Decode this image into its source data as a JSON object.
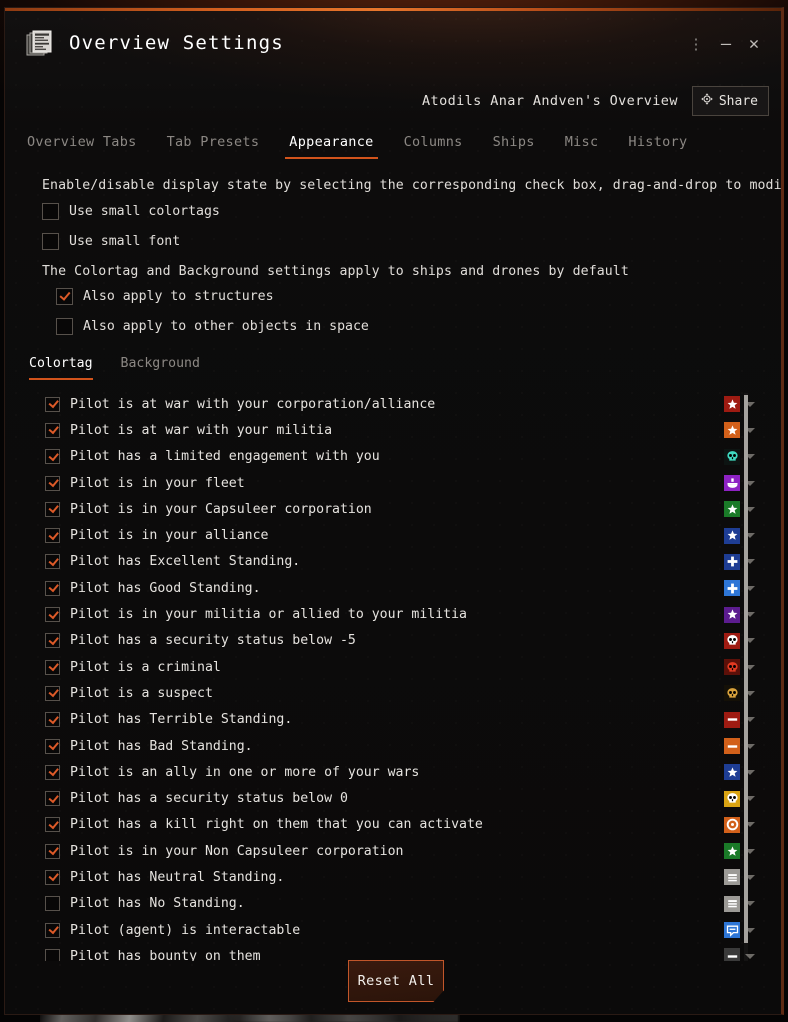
{
  "window": {
    "title": "Overview Settings",
    "icon": "overview-stack-icon",
    "more_label": "⋮",
    "minimize_label": "—",
    "close_label": "✕"
  },
  "header": {
    "overview_name": "Atodils Anar Andven's Overview",
    "share_label": "Share",
    "share_icon": "share-node-icon"
  },
  "tabs": [
    {
      "label": "Overview Tabs",
      "active": false
    },
    {
      "label": "Tab Presets",
      "active": false
    },
    {
      "label": "Appearance",
      "active": true
    },
    {
      "label": "Columns",
      "active": false
    },
    {
      "label": "Ships",
      "active": false
    },
    {
      "label": "Misc",
      "active": false
    },
    {
      "label": "History",
      "active": false
    }
  ],
  "appearance": {
    "description_top": "Enable/disable display state by selecting the corresponding check box, drag-and-drop to modify priority",
    "description_mid": "The Colortag and Background settings apply to ships and drones by default",
    "options": [
      {
        "label": "Use small colortags",
        "checked": false
      },
      {
        "label": "Use small font",
        "checked": false
      },
      {
        "label": "Also apply to structures",
        "checked": true
      },
      {
        "label": "Also apply to other objects in space",
        "checked": false
      }
    ]
  },
  "subtabs": [
    {
      "label": "Colortag",
      "active": true
    },
    {
      "label": "Background",
      "active": false
    }
  ],
  "colortag_list": [
    {
      "label": "Pilot is at war with your corporation/alliance",
      "checked": true,
      "tag": {
        "shape": "star",
        "bg": "#9e1b12",
        "fg": "#ffffff"
      }
    },
    {
      "label": "Pilot is at war with your militia",
      "checked": true,
      "tag": {
        "shape": "star",
        "bg": "#d2601a",
        "fg": "#ffffff"
      }
    },
    {
      "label": "Pilot has a limited engagement with you",
      "checked": true,
      "tag": {
        "shape": "skull",
        "bg": "#0d1412",
        "fg": "#3fd9c0"
      }
    },
    {
      "label": "Pilot is in your fleet",
      "checked": true,
      "tag": {
        "shape": "fleet",
        "bg": "#8e22c4",
        "fg": "#ffffff"
      }
    },
    {
      "label": "Pilot is in your Capsuleer corporation",
      "checked": true,
      "tag": {
        "shape": "star",
        "bg": "#1a7a28",
        "fg": "#ffffff"
      }
    },
    {
      "label": "Pilot is in your alliance",
      "checked": true,
      "tag": {
        "shape": "star",
        "bg": "#1e3d94",
        "fg": "#ffffff"
      }
    },
    {
      "label": "Pilot has Excellent Standing.",
      "checked": true,
      "tag": {
        "shape": "plus",
        "bg": "#1e3d94",
        "fg": "#ffffff"
      }
    },
    {
      "label": "Pilot has Good Standing.",
      "checked": true,
      "tag": {
        "shape": "plus",
        "bg": "#2e76d6",
        "fg": "#ffffff"
      }
    },
    {
      "label": "Pilot is in your militia or allied to your militia",
      "checked": true,
      "tag": {
        "shape": "star",
        "bg": "#5c1c8f",
        "fg": "#ffffff"
      }
    },
    {
      "label": "Pilot has a security status below -5",
      "checked": true,
      "tag": {
        "shape": "skull",
        "bg": "#9e1b12",
        "fg": "#ffffff"
      }
    },
    {
      "label": "Pilot is a criminal",
      "checked": true,
      "tag": {
        "shape": "skull",
        "bg": "#5c1009",
        "fg": "#e23a22"
      }
    },
    {
      "label": "Pilot is a suspect",
      "checked": true,
      "tag": {
        "shape": "skull",
        "bg": "#141007",
        "fg": "#d9a23c"
      }
    },
    {
      "label": "Pilot has Terrible Standing.",
      "checked": true,
      "tag": {
        "shape": "minus",
        "bg": "#9e1b12",
        "fg": "#ffffff"
      }
    },
    {
      "label": "Pilot has Bad Standing.",
      "checked": true,
      "tag": {
        "shape": "minus",
        "bg": "#d2601a",
        "fg": "#ffffff"
      }
    },
    {
      "label": "Pilot is an ally in one or more of your wars",
      "checked": true,
      "tag": {
        "shape": "star",
        "bg": "#1e3d94",
        "fg": "#ffffff"
      }
    },
    {
      "label": "Pilot has a security status below 0",
      "checked": true,
      "tag": {
        "shape": "skull",
        "bg": "#d9a313",
        "fg": "#ffffff"
      }
    },
    {
      "label": "Pilot has a kill right on them that you can activate",
      "checked": true,
      "tag": {
        "shape": "target",
        "bg": "#d2601a",
        "fg": "#ffffff"
      }
    },
    {
      "label": "Pilot is in your Non Capsuleer corporation",
      "checked": true,
      "tag": {
        "shape": "star",
        "bg": "#1a7a28",
        "fg": "#ffffff"
      }
    },
    {
      "label": "Pilot has Neutral Standing.",
      "checked": true,
      "tag": {
        "shape": "bars",
        "bg": "#9c9a96",
        "fg": "#ffffff"
      }
    },
    {
      "label": "Pilot has No Standing.",
      "checked": false,
      "tag": {
        "shape": "bars",
        "bg": "#9c9a96",
        "fg": "#ffffff"
      }
    },
    {
      "label": "Pilot (agent) is interactable",
      "checked": true,
      "tag": {
        "shape": "chat",
        "bg": "#2e76d6",
        "fg": "#ffffff"
      }
    },
    {
      "label": "Pilot has bounty on them",
      "checked": false,
      "tag": {
        "shape": "minus",
        "bg": "#3a3a3a",
        "fg": "#ffffff"
      }
    }
  ],
  "footer": {
    "reset_label": "Reset All"
  },
  "colors": {
    "accent": "#d2541c",
    "window_bg": "#0b0a0a",
    "text": "#e6e3df",
    "text_dim": "#8c8884",
    "checkmark": "#dd5a28"
  }
}
